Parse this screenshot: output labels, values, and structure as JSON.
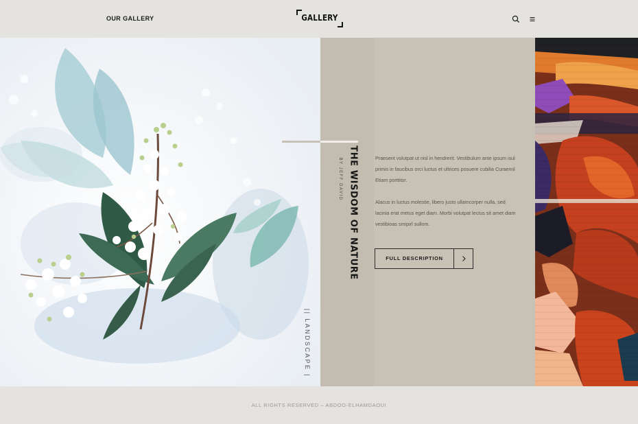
{
  "header": {
    "nav_label": "OUR GALLERY",
    "logo_text": "GALLERY",
    "search_icon": "search-icon",
    "menu_icon": "hamburger-menu-icon"
  },
  "feature": {
    "category": "|| LANDSCAPE |",
    "title": "THE WISDOM OF NATURE",
    "author": "BY JEFF DAVID",
    "description_1": "Praesent volutpat ut nisl in hendrerit. Vestibulum ante ipsum isul primis in faucibus orci luctus et ultrices posuere cubilia Curaemil Etiam porttitor.",
    "description_2": "Alacus in luctus molestie, libero justo ullamcorper nulla, sed lacinia erat metus eget diam. Morbi volutpat lectus sit amet diam vestibioas smipirl sullom.",
    "button_label": "FULL DESCRIPTION",
    "button_icon": "chevron-right-icon"
  },
  "images": {
    "left": "botanical-flowers-photo",
    "right": "abstract-mural-photo"
  },
  "footer": {
    "copyright": "ALL RIGHTS RESERVED – ABDOO-ELHAMDAOUI"
  },
  "colors": {
    "header_bg": "#e4e3df",
    "panel_bg": "#c8c1b6",
    "text_dark": "#151515",
    "text_muted": "#5a554d"
  }
}
